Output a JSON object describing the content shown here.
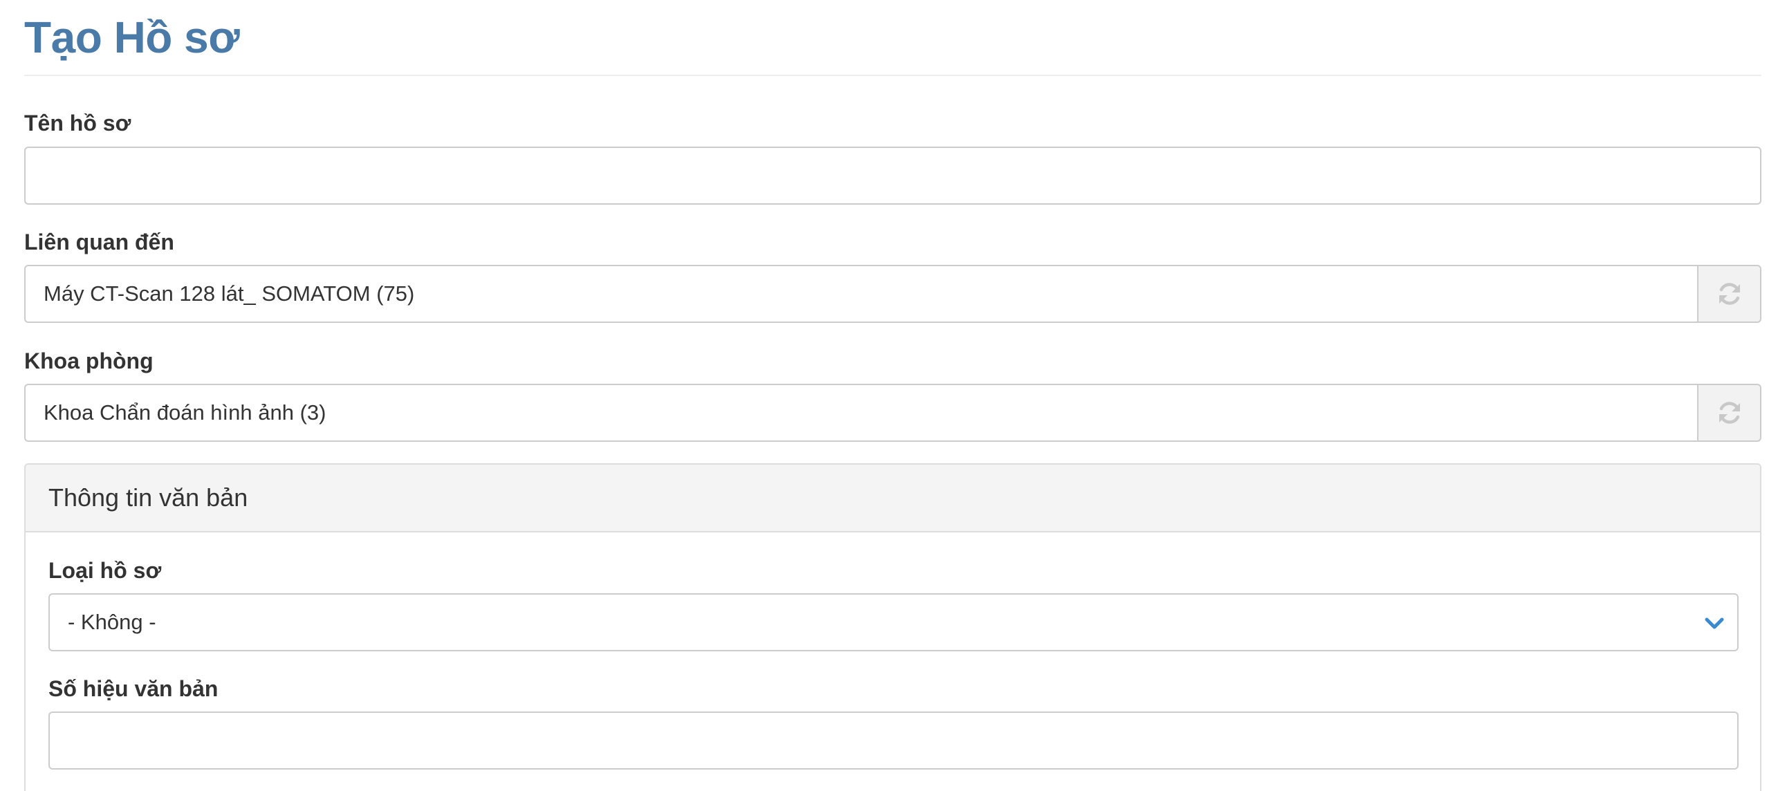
{
  "page": {
    "title": "Tạo Hồ sơ"
  },
  "form": {
    "ten_ho_so": {
      "label": "Tên hồ sơ",
      "value": ""
    },
    "lien_quan_den": {
      "label": "Liên quan đến",
      "value": "Máy CT-Scan 128 lát_ SOMATOM (75)",
      "addon_icon": "refresh-icon"
    },
    "khoa_phong": {
      "label": "Khoa phòng",
      "value": "Khoa Chẩn đoán hình ảnh (3)",
      "addon_icon": "refresh-icon"
    }
  },
  "panel": {
    "title": "Thông tin văn bản",
    "loai_ho_so": {
      "label": "Loại hồ sơ",
      "selected": "- Không -",
      "icon": "chevron-down-icon"
    },
    "so_hieu_van_ban": {
      "label": "Số hiệu văn bản",
      "value": ""
    }
  },
  "colors": {
    "title": "#4a7aa8",
    "accent": "#3a8ad0",
    "border": "#cccccc",
    "panel_heading_bg": "#f4f4f4",
    "addon_bg": "#f2f2f2"
  }
}
